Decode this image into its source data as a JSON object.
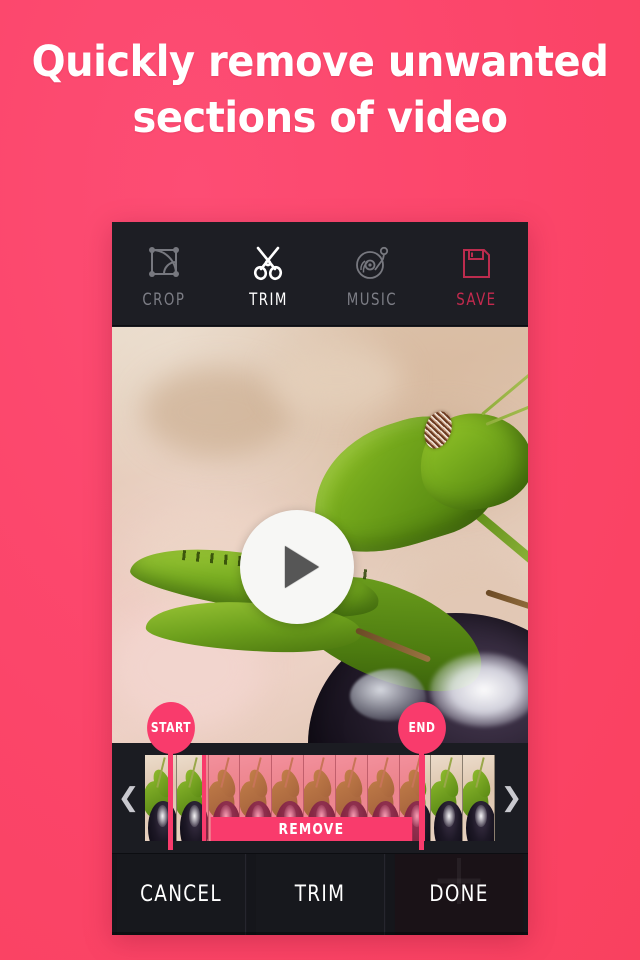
{
  "headline": {
    "line1": "Quickly remove unwanted",
    "line2": "sections of video"
  },
  "colors": {
    "background_pink": "#FB4569",
    "accent_pink": "#F93B6C",
    "panel_dark": "#191A20",
    "toolbar_dark": "#1D1E24",
    "save_red": "#C42A4E",
    "label_gray": "#7C7D85",
    "white": "#FFFFFF"
  },
  "toolbar": {
    "items": [
      {
        "label": "CROP",
        "icon": "crop-icon",
        "state": "inactive"
      },
      {
        "label": "TRIM",
        "icon": "scissors-icon",
        "state": "active"
      },
      {
        "label": "MUSIC",
        "icon": "vinyl-record-icon",
        "state": "inactive"
      },
      {
        "label": "SAVE",
        "icon": "floppy-disk-icon",
        "state": "accent"
      }
    ]
  },
  "video": {
    "play_icon": "play-icon",
    "subject": "grasshopper on eggplant"
  },
  "timeline": {
    "prev_icon": "chevron-left-icon",
    "next_icon": "chevron-right-icon",
    "start_label": "START",
    "end_label": "END",
    "remove_label": "REMOVE",
    "frame_count": 11,
    "selection_start_pct": 16.4,
    "selection_width_pct": 62.5
  },
  "bottom_bar": {
    "buttons": [
      {
        "label": "CANCEL"
      },
      {
        "label": "TRIM"
      },
      {
        "label": "DONE"
      }
    ]
  }
}
